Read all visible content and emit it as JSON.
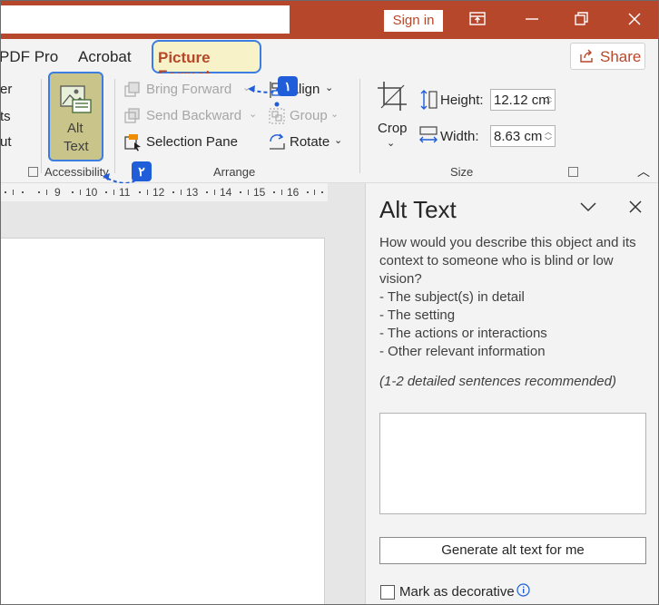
{
  "titlebar": {
    "signin_label": "Sign in"
  },
  "tabs": {
    "pdf_pro": "PDF Pro",
    "acrobat": "Acrobat",
    "picture_format": "Picture Format",
    "share_label": "Share"
  },
  "ribbon": {
    "left_partial": [
      "er",
      "ts",
      "ut"
    ],
    "accessibility": {
      "button_line1": "Alt",
      "button_line2": "Text",
      "group_label": "Accessibility"
    },
    "arrange": {
      "bring_forward": "Bring Forward",
      "send_backward": "Send Backward",
      "selection_pane": "Selection Pane",
      "align": "Align",
      "group": "Group",
      "rotate": "Rotate",
      "group_label": "Arrange"
    },
    "size": {
      "crop": "Crop",
      "height_label": "Height:",
      "height_value": "12.12 cm",
      "width_label": "Width:",
      "width_value": "8.63 cm",
      "group_label": "Size"
    },
    "badges": {
      "one": "١",
      "two": "٢"
    }
  },
  "ruler": {
    "numbers": [
      "9",
      "10",
      "11",
      "12",
      "13",
      "14",
      "15",
      "16"
    ]
  },
  "alt_text_pane": {
    "title": "Alt Text",
    "description": "How would you describe this object and its context to someone who is blind or low vision?",
    "bullets": [
      "- The subject(s) in detail",
      "- The setting",
      "- The actions or interactions",
      "- Other relevant information"
    ],
    "note": "(1-2 detailed sentences recommended)",
    "input_value": "",
    "generate_button": "Generate alt text for me",
    "decorative_label": "Mark as decorative"
  },
  "colors": {
    "accent": "#b7472a",
    "highlight_border": "#3b7de0",
    "badge": "#1f5ed8"
  }
}
